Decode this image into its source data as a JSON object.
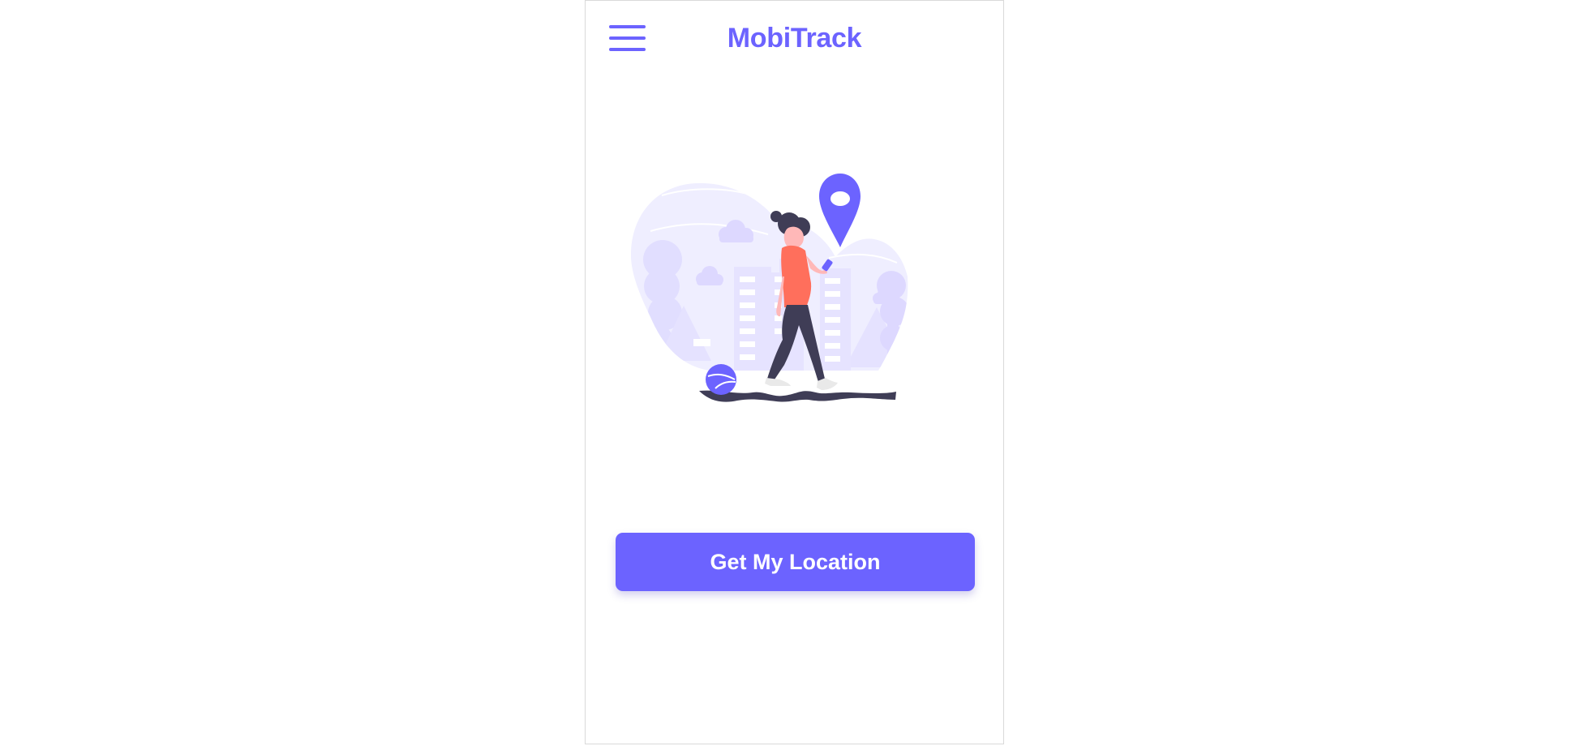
{
  "app": {
    "title": "MobiTrack"
  },
  "header": {
    "menu_icon": "hamburger-menu-icon"
  },
  "illustration": {
    "subject": "woman-walking-with-phone-location-pin",
    "icon": "location-pin-icon"
  },
  "main": {
    "action_label": "Get My Location"
  },
  "colors": {
    "accent": "#6c63ff",
    "illustration_light": "#e8e6ff",
    "illustration_mid": "#ded9ff",
    "shirt": "#ff6f5c",
    "dark": "#3f3d56",
    "border": "#d9d9d9"
  }
}
